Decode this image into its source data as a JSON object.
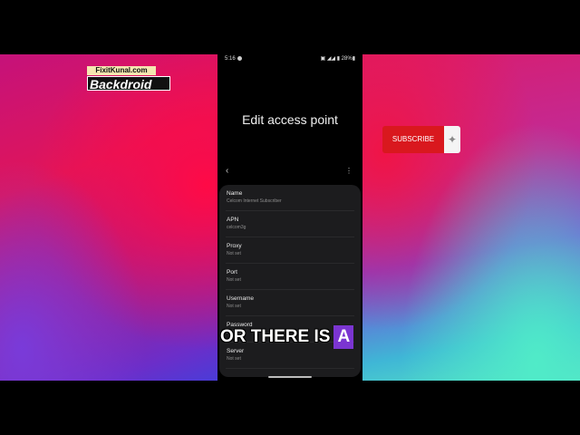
{
  "logo": {
    "top": "FixitKunal.com",
    "main": "Backdroid"
  },
  "subscribe": {
    "label": "SUBSCRIBE",
    "icon": "bell-icon"
  },
  "status_bar": {
    "time": "5:16",
    "right": "▣ ◢◢ ▮ 28%▮"
  },
  "screen": {
    "title": "Edit access point",
    "back_icon": "back-arrow-icon",
    "more_icon": "more-options-icon",
    "fields": [
      {
        "label": "Name",
        "value": "Celcom Internet Subscriber"
      },
      {
        "label": "APN",
        "value": "celcom3g"
      },
      {
        "label": "Proxy",
        "value": "Not set"
      },
      {
        "label": "Port",
        "value": "Not set"
      },
      {
        "label": "Username",
        "value": "Not set"
      },
      {
        "label": "Password",
        "value": "Not set"
      },
      {
        "label": "Server",
        "value": "Not set"
      }
    ]
  },
  "caption": {
    "text": "OR THERE IS",
    "highlight": "A"
  },
  "colors": {
    "subscribe_red": "#d9181e",
    "card_bg": "#1c1c1e",
    "caption_highlight": "#7b35d1"
  }
}
